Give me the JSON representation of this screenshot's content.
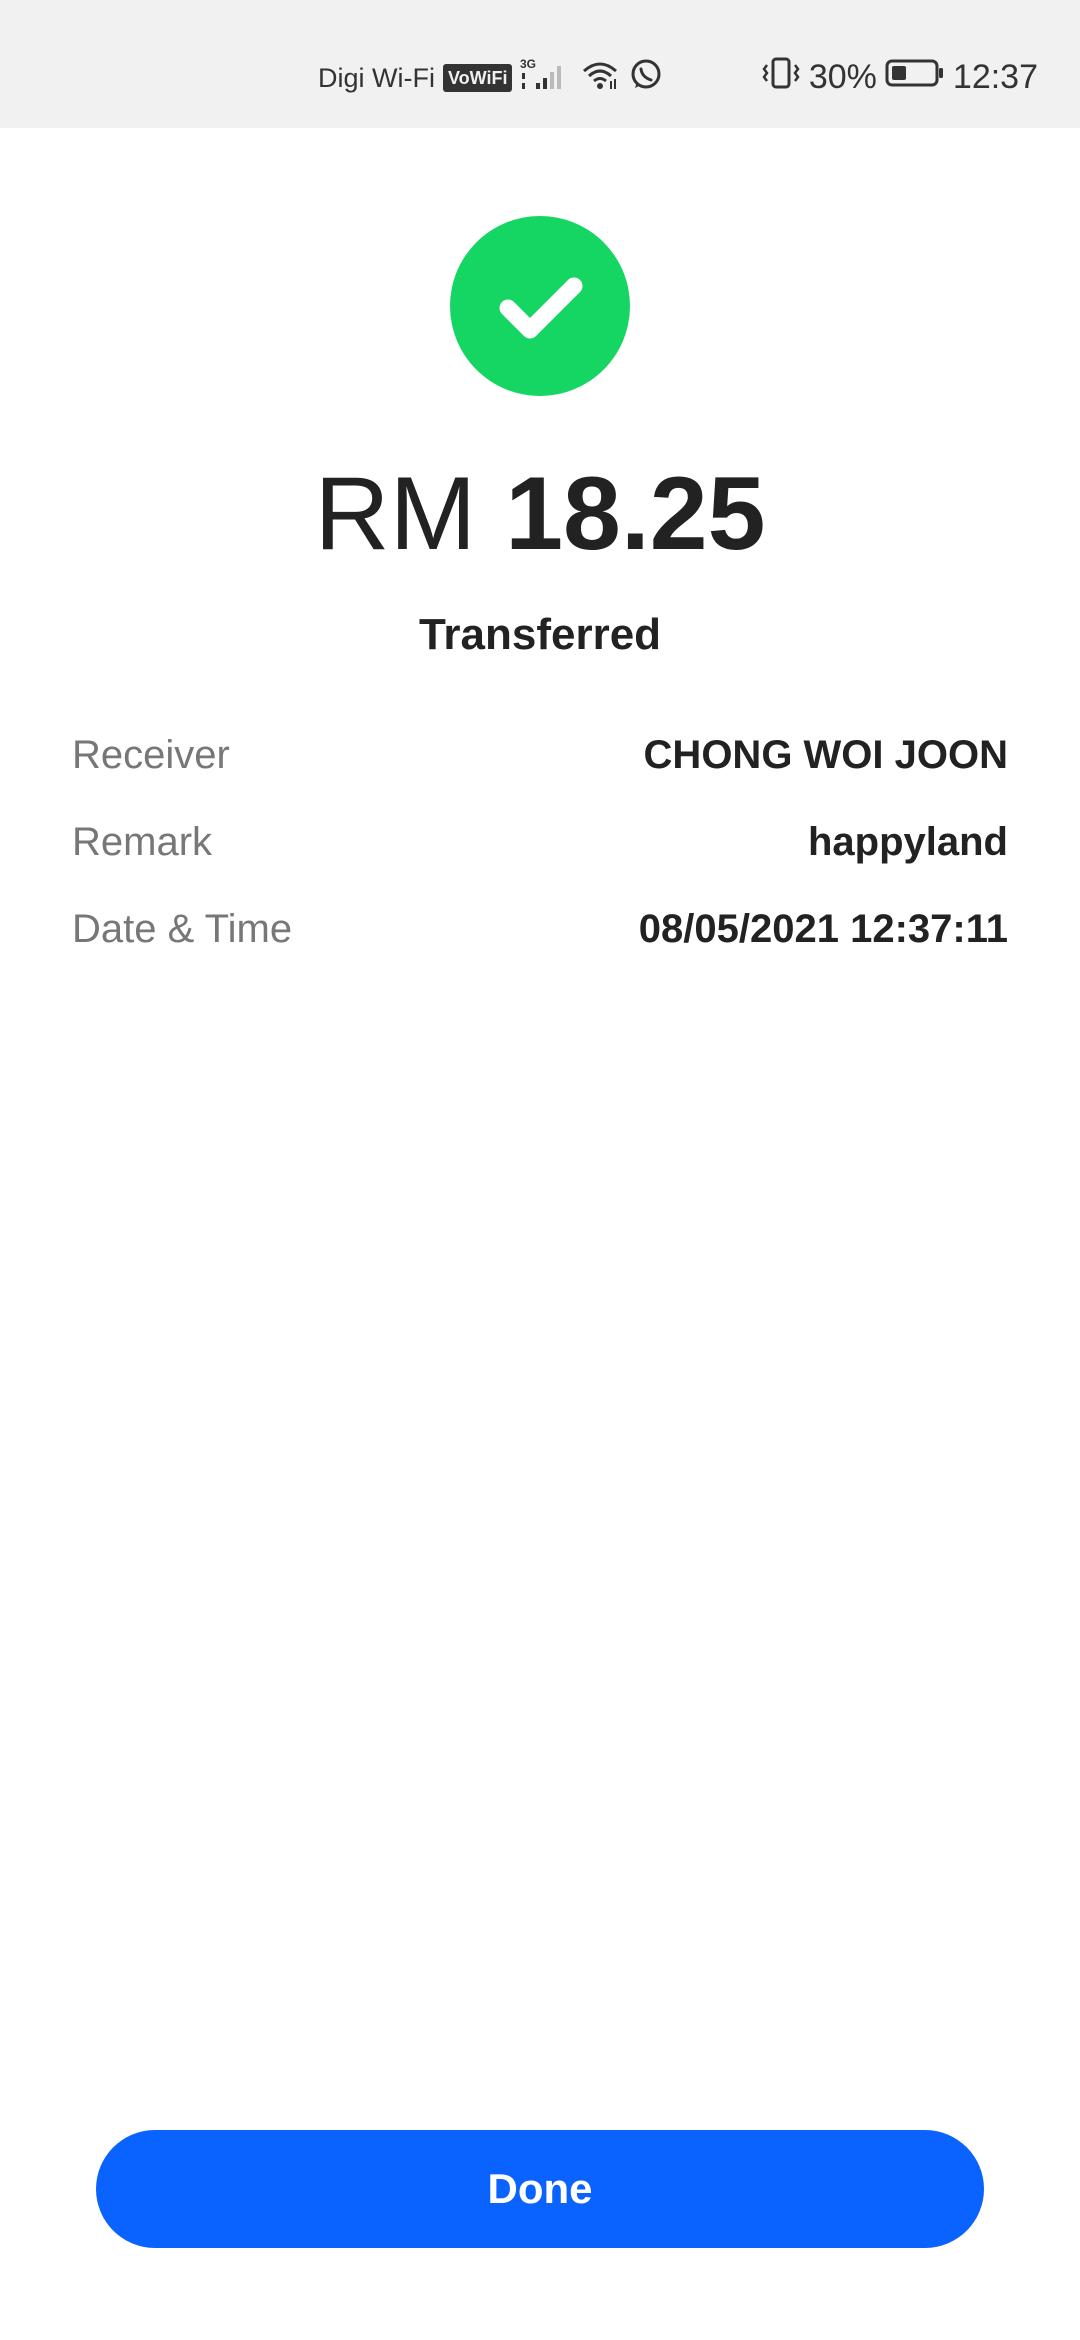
{
  "status_bar": {
    "carrier": "Digi Wi-Fi",
    "vowifi_badge": "VoWiFi",
    "network_type": "3G",
    "battery_percent": "30%",
    "time": "12:37",
    "icons": [
      "vowifi-icon",
      "cellular-signal-icon",
      "wifi-icon",
      "whatsapp-icon",
      "vibrate-icon",
      "battery-icon"
    ]
  },
  "result": {
    "icon": "check-icon",
    "accent_color": "#15d662",
    "currency": "RM",
    "amount": "18.25",
    "status": "Transferred"
  },
  "details": [
    {
      "label": "Receiver",
      "value": "CHONG WOI JOON"
    },
    {
      "label": "Remark",
      "value": "happyland"
    },
    {
      "label": "Date & Time",
      "value": "08/05/2021 12:37:11"
    }
  ],
  "actions": {
    "done_label": "Done",
    "done_color": "#0a63ff"
  }
}
